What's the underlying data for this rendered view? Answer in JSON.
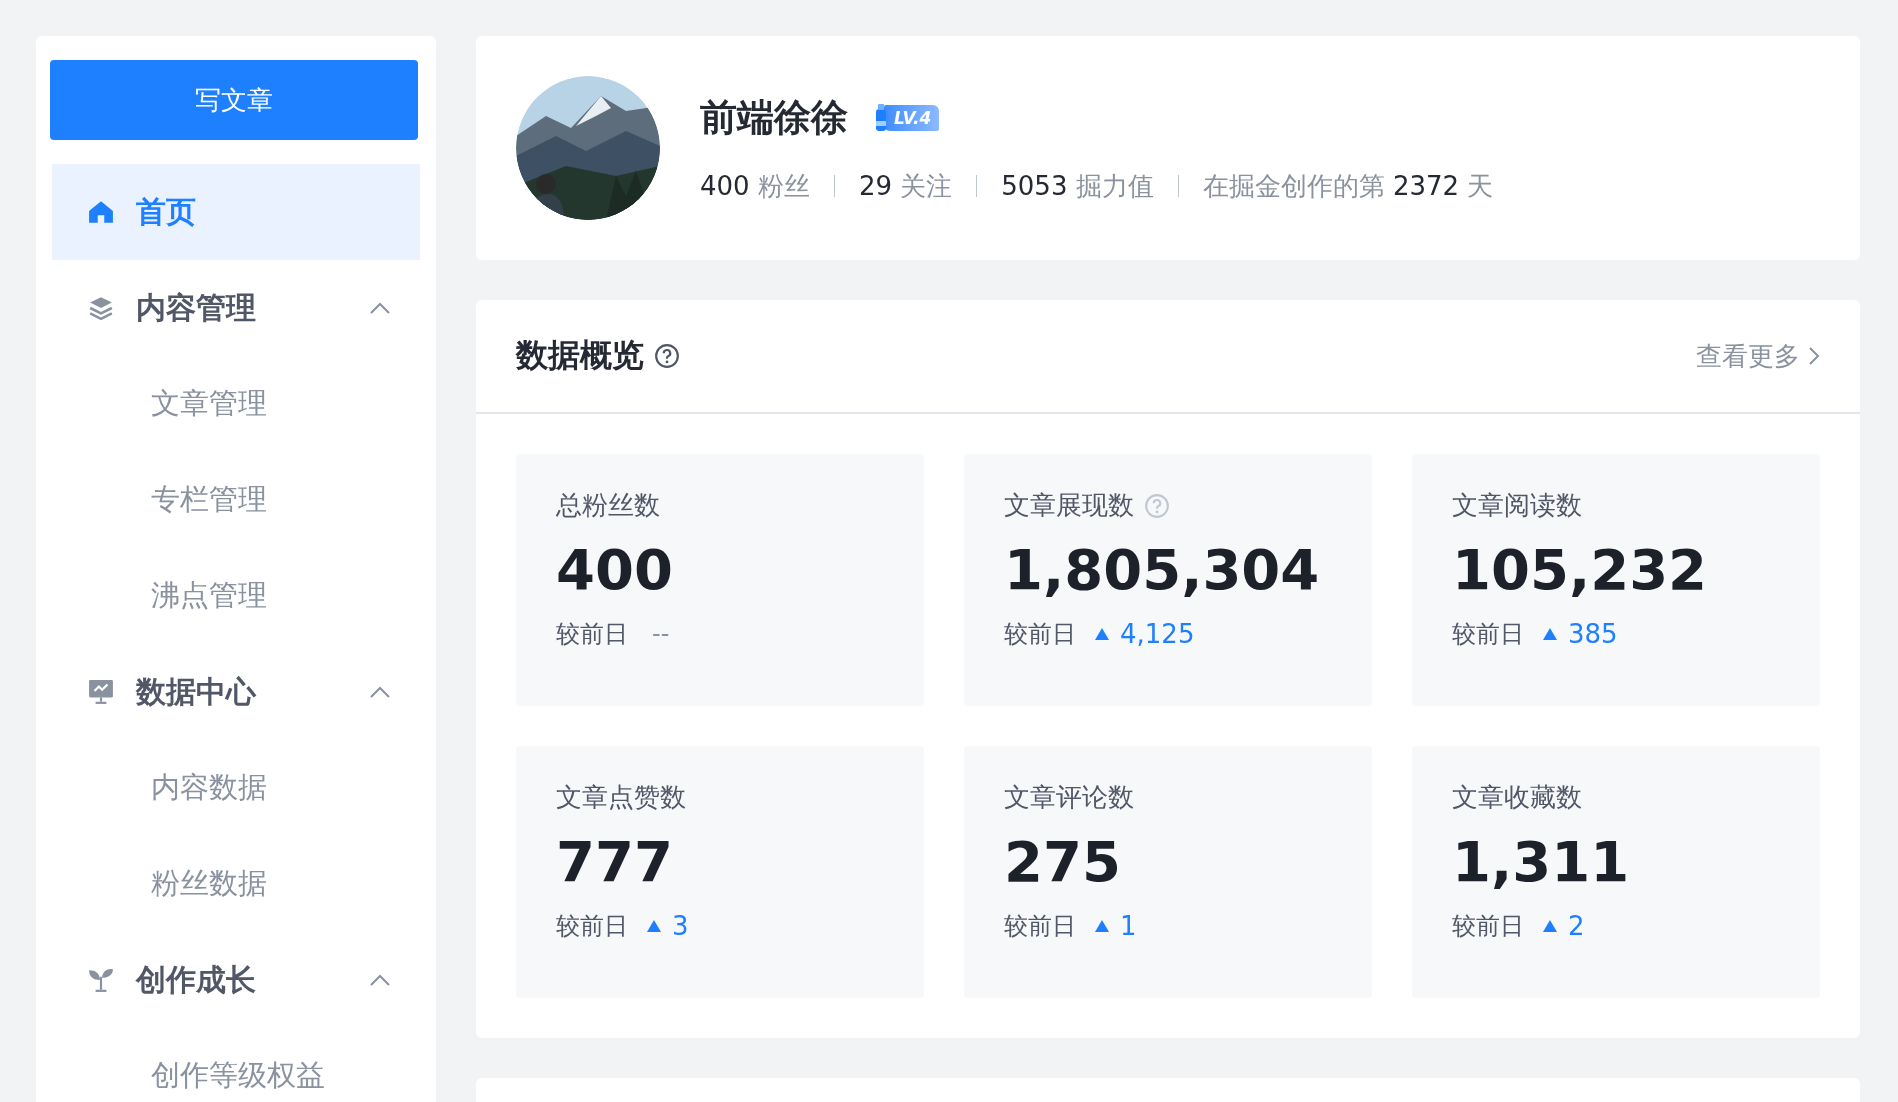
{
  "sidebar": {
    "write_button": "写文章",
    "items": [
      {
        "kind": "link",
        "label": "首页",
        "selected": true
      },
      {
        "kind": "group",
        "label": "内容管理",
        "expanded": true,
        "children": [
          {
            "label": "文章管理",
            "selected": false
          },
          {
            "label": "专栏管理",
            "selected": false
          },
          {
            "label": "沸点管理",
            "selected": false
          }
        ]
      },
      {
        "kind": "group",
        "label": "数据中心",
        "expanded": true,
        "children": [
          {
            "label": "内容数据",
            "selected": false
          },
          {
            "label": "粉丝数据",
            "selected": false
          }
        ]
      },
      {
        "kind": "group",
        "label": "创作成长",
        "expanded": true,
        "children": [
          {
            "label": "创作等级权益",
            "selected": false
          }
        ]
      }
    ]
  },
  "profile": {
    "name": "前端徐徐",
    "level": "LV.4",
    "stats": [
      {
        "value": "400",
        "label": "粉丝"
      },
      {
        "value": "29",
        "label": "关注"
      },
      {
        "value": "5053",
        "label": "掘力值"
      }
    ],
    "days": {
      "prefix": "在掘金创作的第",
      "value": "2372",
      "suffix": "天"
    }
  },
  "overview": {
    "title": "数据概览",
    "more": "查看更多",
    "cards": [
      {
        "label": "总粉丝数",
        "help": false,
        "value": "400",
        "compare": "较前日",
        "rising": false,
        "delta": "--"
      },
      {
        "label": "文章展现数",
        "help": true,
        "value": "1,805,304",
        "compare": "较前日",
        "rising": true,
        "delta": "4,125"
      },
      {
        "label": "文章阅读数",
        "help": false,
        "value": "105,232",
        "compare": "较前日",
        "rising": true,
        "delta": "385"
      },
      {
        "label": "文章点赞数",
        "help": false,
        "value": "777",
        "compare": "较前日",
        "rising": true,
        "delta": "3"
      },
      {
        "label": "文章评论数",
        "help": false,
        "value": "275",
        "compare": "较前日",
        "rising": true,
        "delta": "1"
      },
      {
        "label": "文章收藏数",
        "help": false,
        "value": "1,311",
        "compare": "较前日",
        "rising": true,
        "delta": "2"
      }
    ]
  }
}
